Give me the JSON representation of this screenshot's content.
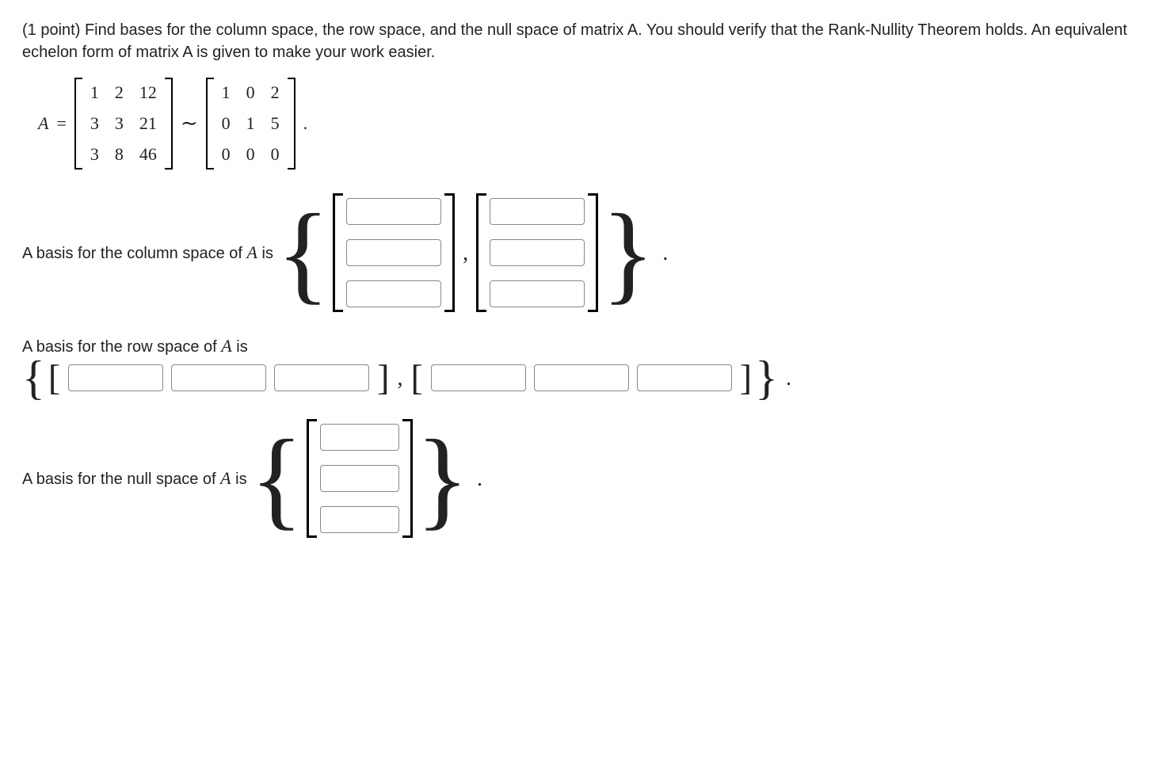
{
  "problem": {
    "points_prefix": "(1 point) ",
    "text": "Find bases for the column space, the row space, and the null space of matrix A. You should verify that the Rank-Nullity Theorem holds. An equivalent echelon form of matrix A is given to make your work easier."
  },
  "equation": {
    "A_label": "A",
    "equals": "=",
    "tilde": "∼",
    "period": ".",
    "matrixA": [
      [
        "1",
        "2",
        "12"
      ],
      [
        "3",
        "3",
        "21"
      ],
      [
        "3",
        "8",
        "46"
      ]
    ],
    "matrixE": [
      [
        "1",
        "0",
        "2"
      ],
      [
        "0",
        "1",
        "5"
      ],
      [
        "0",
        "0",
        "0"
      ]
    ]
  },
  "prompts": {
    "column_space_pre": "A basis for the column space of ",
    "column_space_post": " is",
    "row_space_pre": "A basis for the row space of ",
    "row_space_post": " is",
    "null_space_pre": "A basis for the null space of ",
    "null_space_post": " is",
    "A_symbol": "A"
  },
  "braces": {
    "open": "{",
    "close": "}",
    "lbracket": "[",
    "rbracket": "]",
    "comma": ",",
    "period": "."
  },
  "inputs": {
    "col_space": {
      "vec1": [
        "",
        "",
        ""
      ],
      "vec2": [
        "",
        "",
        ""
      ]
    },
    "row_space": {
      "vec1": [
        "",
        "",
        ""
      ],
      "vec2": [
        "",
        "",
        ""
      ]
    },
    "null_space": {
      "vec1": [
        "",
        "",
        ""
      ]
    }
  }
}
